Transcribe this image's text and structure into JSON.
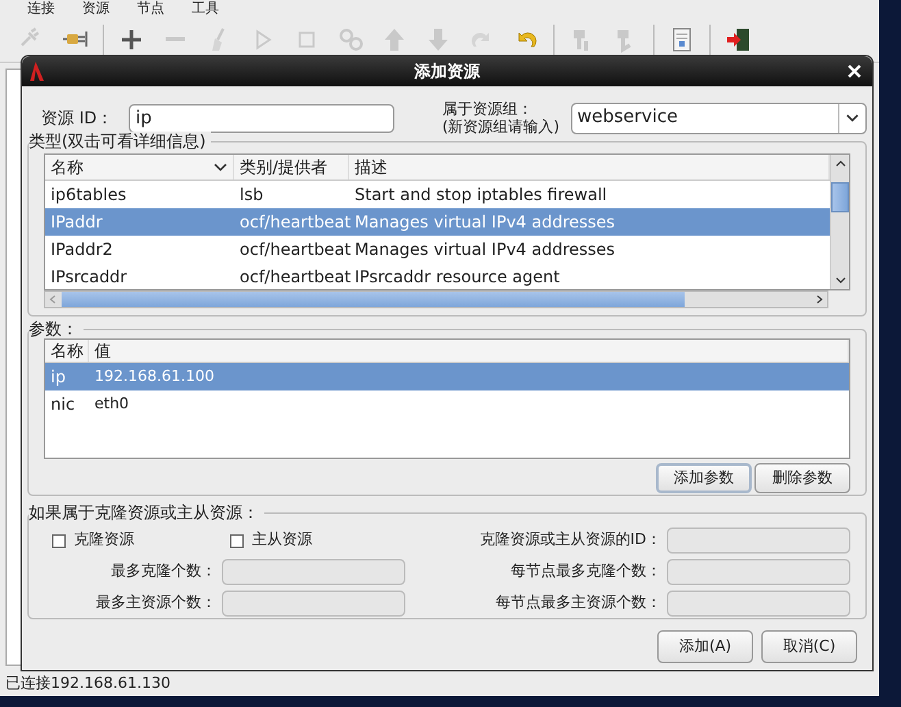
{
  "menu": [
    "连接",
    "资源",
    "节点",
    "工具"
  ],
  "toolbar": [
    {
      "kind": "plug-off",
      "disabled": true
    },
    {
      "kind": "plug",
      "disabled": false
    },
    {
      "kind": "plus",
      "disabled": false
    },
    {
      "kind": "minus",
      "disabled": true
    },
    {
      "kind": "broom",
      "disabled": true
    },
    {
      "kind": "play",
      "disabled": true
    },
    {
      "kind": "stop",
      "disabled": true
    },
    {
      "kind": "gears",
      "disabled": true
    },
    {
      "kind": "up",
      "disabled": true
    },
    {
      "kind": "down",
      "disabled": true
    },
    {
      "kind": "redo",
      "disabled": true
    },
    {
      "kind": "undo",
      "disabled": false
    },
    {
      "kind": "node-up",
      "disabled": true
    },
    {
      "kind": "node-down",
      "disabled": true
    },
    {
      "kind": "document",
      "disabled": false
    },
    {
      "kind": "exit",
      "disabled": false
    }
  ],
  "dialog": {
    "title": "添加资源",
    "id_label": "资源 ID：",
    "id_value": "ip",
    "group_label": [
      "属于资源组：",
      "(新资源组请输入)"
    ],
    "group_value": "webservice",
    "type_section": "类型(双击可看详细信息)",
    "type_columns": [
      "名称",
      "类别/提供者",
      "描述"
    ],
    "type_rows": [
      {
        "name": "ip6tables",
        "provider": "lsb",
        "description": "Start and stop iptables firewall",
        "selected": false
      },
      {
        "name": "IPaddr",
        "provider": "ocf/heartbeat",
        "description": "Manages virtual IPv4 addresses",
        "selected": true
      },
      {
        "name": "IPaddr2",
        "provider": "ocf/heartbeat",
        "description": "Manages virtual IPv4 addresses",
        "selected": false
      },
      {
        "name": "IPsrcaddr",
        "provider": "ocf/heartbeat",
        "description": "IPsrcaddr resource agent",
        "selected": false
      }
    ],
    "params_section": "参数：",
    "param_columns": [
      "名称",
      "值"
    ],
    "param_rows": [
      {
        "name": "ip",
        "value": "192.168.61.100",
        "selected": true
      },
      {
        "name": "nic",
        "value": "eth0",
        "selected": false
      }
    ],
    "param_buttons": [
      "添加参数",
      "删除参数"
    ],
    "clone_section": "如果属于克隆资源或主从资源：",
    "checkboxes": [
      {
        "label": "克隆资源",
        "checked": false
      },
      {
        "label": "主从资源",
        "checked": false
      }
    ],
    "clone_id_label": "克隆资源或主从资源的ID：",
    "fields": [
      {
        "label": "最多克隆个数：",
        "disabled": true
      },
      {
        "label": "每节点最多克隆个数：",
        "disabled": true
      },
      {
        "label": "最多主资源个数：",
        "disabled": true
      },
      {
        "label": "每节点最多主资源个数：",
        "disabled": true
      }
    ],
    "buttons": [
      "添加(A)",
      "取消(C)"
    ]
  },
  "status_bar": "已连接192.168.61.130"
}
